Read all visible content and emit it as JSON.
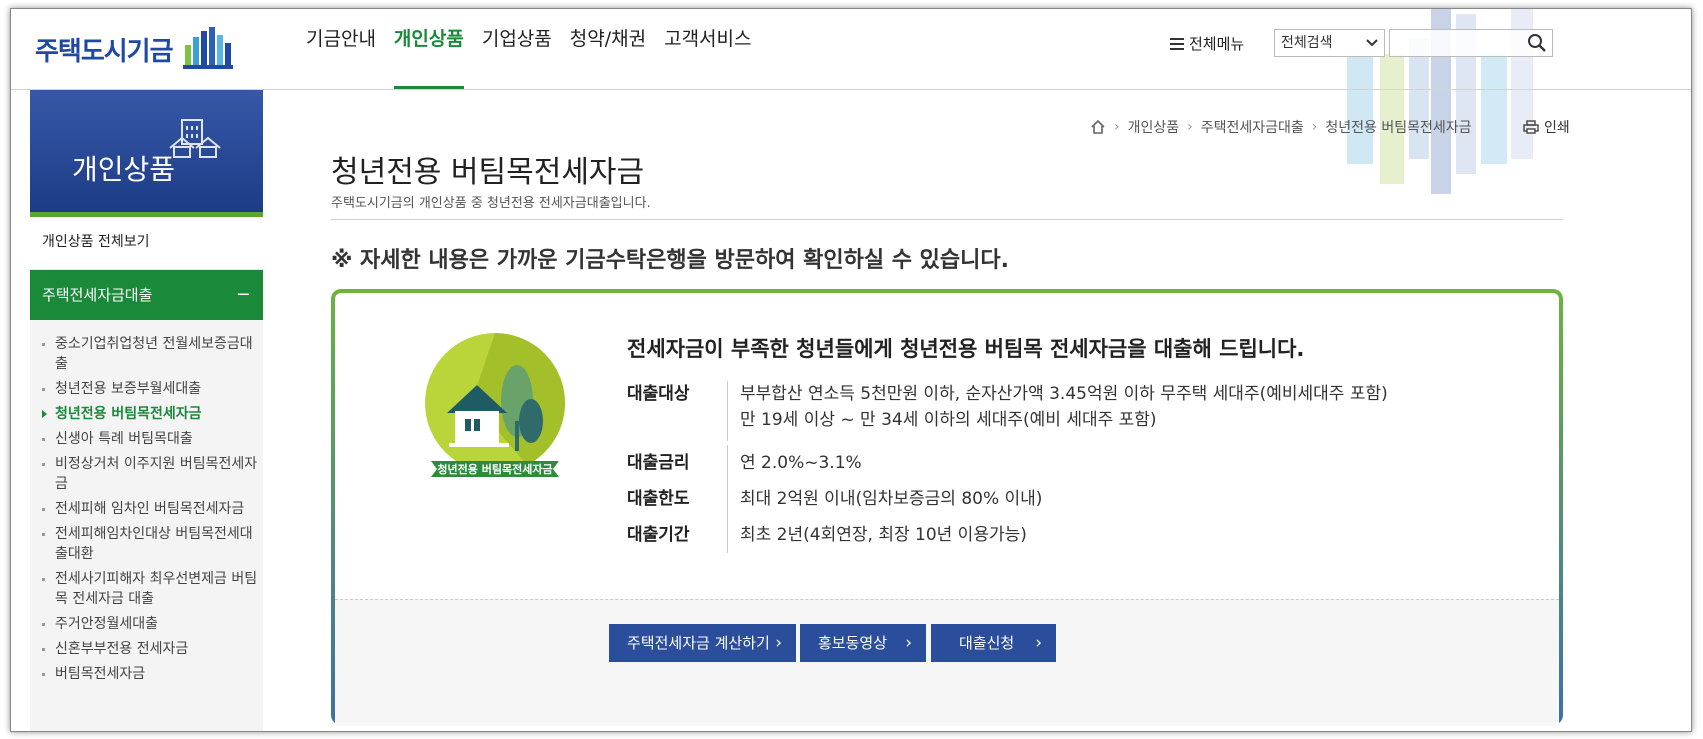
{
  "header": {
    "logo_text": "주택도시기금",
    "nav": [
      {
        "label": "기금안내"
      },
      {
        "label": "개인상품",
        "active": true
      },
      {
        "label": "기업상품"
      },
      {
        "label": "청약/채권"
      },
      {
        "label": "고객서비스"
      }
    ],
    "all_menu_label": "전체메뉴",
    "search_select_value": "전체검색",
    "search_placeholder": ""
  },
  "sidebar": {
    "hero_title": "개인상품",
    "all_view_label": "개인상품 전체보기",
    "category_label": "주택전세자금대출",
    "category_toggle": "−",
    "items": [
      {
        "label": "중소기업취업청년 전월세보증금대출"
      },
      {
        "label": "청년전용 보증부월세대출"
      },
      {
        "label": "청년전용 버팀목전세자금",
        "active": true
      },
      {
        "label": "신생아 특례 버팀목대출"
      },
      {
        "label": "비정상거처 이주지원 버팀목전세자금"
      },
      {
        "label": "전세피해 임차인 버팀목전세자금"
      },
      {
        "label": "전세피해임차인대상 버팀목전세대출대환"
      },
      {
        "label": "전세사기피해자 최우선변제금 버팀목 전세자금 대출"
      },
      {
        "label": "주거안정월세대출"
      },
      {
        "label": "신혼부부전용 전세자금"
      },
      {
        "label": "버팀목전세자금"
      }
    ]
  },
  "breadcrumb": [
    "개인상품",
    "주택전세자금대출",
    "청년전용 버팀목전세자금"
  ],
  "print_label": "인쇄",
  "page": {
    "title": "청년전용 버팀목전세자금",
    "subtitle": "주택도시기금의 개인상품 중 청년전용 전세자금대출입니다.",
    "notice": "※ 자세한 내용은 가까운 기금수탁은행을 방문하여 확인하실 수 있습니다."
  },
  "product": {
    "badge_label": "청년전용 버팀목전세자금",
    "headline": "전세자금이 부족한 청년들에게 청년전용 버팀목 전세자금을 대출해 드립니다.",
    "details": [
      {
        "key": "대출대상",
        "lines": [
          "부부합산 연소득 5천만원 이하, 순자산가액 3.45억원 이하 무주택 세대주(예비세대주 포함)",
          "만 19세 이상 ~ 만 34세 이하의 세대주(예비 세대주 포함)"
        ]
      },
      {
        "key": "대출금리",
        "lines": [
          "연 2.0%~3.1%"
        ]
      },
      {
        "key": "대출한도",
        "lines": [
          "최대 2억원 이내(임차보증금의 80% 이내)"
        ]
      },
      {
        "key": "대출기간",
        "lines": [
          "최초 2년(4회연장, 최장 10년 이용가능)"
        ]
      }
    ],
    "buttons": [
      {
        "label": "주택전세자금 계산하기"
      },
      {
        "label": "홍보동영상"
      },
      {
        "label": "대출신청"
      }
    ]
  },
  "colors": {
    "brand_blue": "#1f4aa1",
    "brand_green": "#1a8a3a",
    "button_blue": "#2a4e9c"
  }
}
